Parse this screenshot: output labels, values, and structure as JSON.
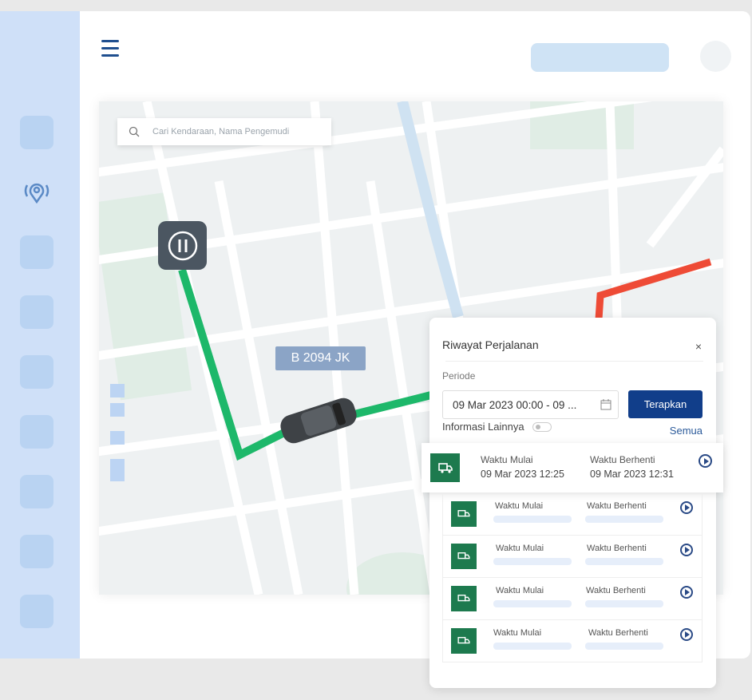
{
  "search": {
    "placeholder": "Cari Kendaraan, Nama Pengemudi"
  },
  "vehicle": {
    "plate": "B 2094 JK"
  },
  "panel": {
    "title": "Riwayat Perjalanan",
    "close": "×",
    "period_label": "Periode",
    "period_value": "09 Mar 2023 00:00 - 09 ...",
    "apply": "Terapkan",
    "more_info": "Informasi Lainnya",
    "all": "Semua",
    "active_trip": {
      "start_label": "Waktu Mulai",
      "start": "09 Mar 2023 12:25",
      "stop_label": "Waktu Berhenti",
      "stop": "09 Mar 2023 12:31"
    },
    "trips": [
      {
        "start_label": "Waktu Mulai",
        "stop_label": "Waktu Berhenti"
      },
      {
        "start_label": "Waktu Mulai",
        "stop_label": "Waktu Berhenti"
      },
      {
        "start_label": "Waktu Mulai",
        "stop_label": "Waktu Berhenti"
      },
      {
        "start_label": "Waktu Mulai",
        "stop_label": "Waktu Berhenti"
      }
    ]
  },
  "colors": {
    "route": "#1db86a",
    "route_alert": "#ee4b36",
    "primary": "#113e8a"
  }
}
